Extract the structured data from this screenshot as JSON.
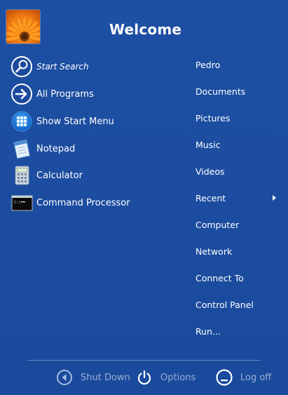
{
  "header": {
    "title": "Welcome",
    "avatar_icon": "flower-avatar-icon"
  },
  "left": {
    "items": [
      {
        "label": "Start Search",
        "icon": "search-icon"
      },
      {
        "label": "All Programs",
        "icon": "arrow-right-circle-icon"
      },
      {
        "label": "Show Start Menu",
        "icon": "start-orb-icon"
      },
      {
        "label": "Notepad",
        "icon": "notepad-icon"
      },
      {
        "label": "Calculator",
        "icon": "calculator-icon"
      },
      {
        "label": "Command Processor",
        "icon": "command-prompt-icon"
      }
    ]
  },
  "right": {
    "items": [
      {
        "label": "Pedro"
      },
      {
        "label": "Documents"
      },
      {
        "label": "Pictures"
      },
      {
        "label": "Music"
      },
      {
        "label": "Videos"
      },
      {
        "label": "Recent",
        "has_submenu": true
      },
      {
        "label": "Computer"
      },
      {
        "label": "Network"
      },
      {
        "label": "Connect To"
      },
      {
        "label": "Control Panel"
      },
      {
        "label": "Run..."
      }
    ]
  },
  "footer": {
    "shutdown_label": "Shut Down",
    "options_label": "Options",
    "logoff_label": "Log off"
  },
  "colors": {
    "background": "#1b4c9f",
    "text": "#ffffff",
    "footer_text": "#8fa6cf"
  }
}
